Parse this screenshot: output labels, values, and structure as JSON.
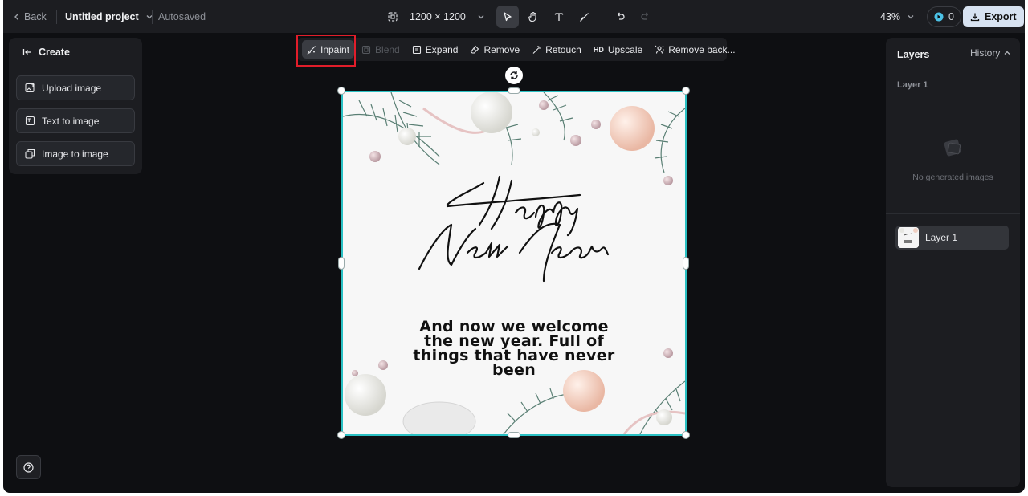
{
  "header": {
    "back_label": "Back",
    "project_name": "Untitled project",
    "save_status": "Autosaved",
    "canvas_size": "1200 × 1200",
    "zoom": "43%",
    "credits": "0",
    "export_label": "Export"
  },
  "left_panel": {
    "title": "Create",
    "items": [
      {
        "label": "Upload image",
        "icon": "upload-image-icon"
      },
      {
        "label": "Text to image",
        "icon": "text-to-image-icon"
      },
      {
        "label": "Image to image",
        "icon": "image-to-image-icon"
      }
    ]
  },
  "context_toolbar": {
    "items": [
      {
        "label": "Inpaint",
        "state": "active",
        "highlighted": true
      },
      {
        "label": "Blend",
        "state": "disabled"
      },
      {
        "label": "Expand",
        "state": "enabled"
      },
      {
        "label": "Remove",
        "state": "enabled"
      },
      {
        "label": "Retouch",
        "state": "enabled"
      },
      {
        "label": "Upscale",
        "badge": "HD",
        "state": "enabled"
      },
      {
        "label": "Remove back...",
        "state": "enabled"
      }
    ]
  },
  "canvas": {
    "headline_line1": "Happy",
    "headline_line2": "New Year",
    "message_lines": [
      "And now we welcome",
      "the new year. Full of",
      "things that have never",
      "been"
    ]
  },
  "right_panel": {
    "title": "Layers",
    "history_label": "History",
    "group_label": "Layer 1",
    "empty_text": "No generated images",
    "layers": [
      {
        "label": "Layer 1"
      }
    ]
  },
  "colors": {
    "app_bg": "#0e0f12",
    "panel_bg": "#1c1d21",
    "selection": "#2ac0c3",
    "highlight": "#e11d2a",
    "export_bg": "#d7e2f1"
  }
}
